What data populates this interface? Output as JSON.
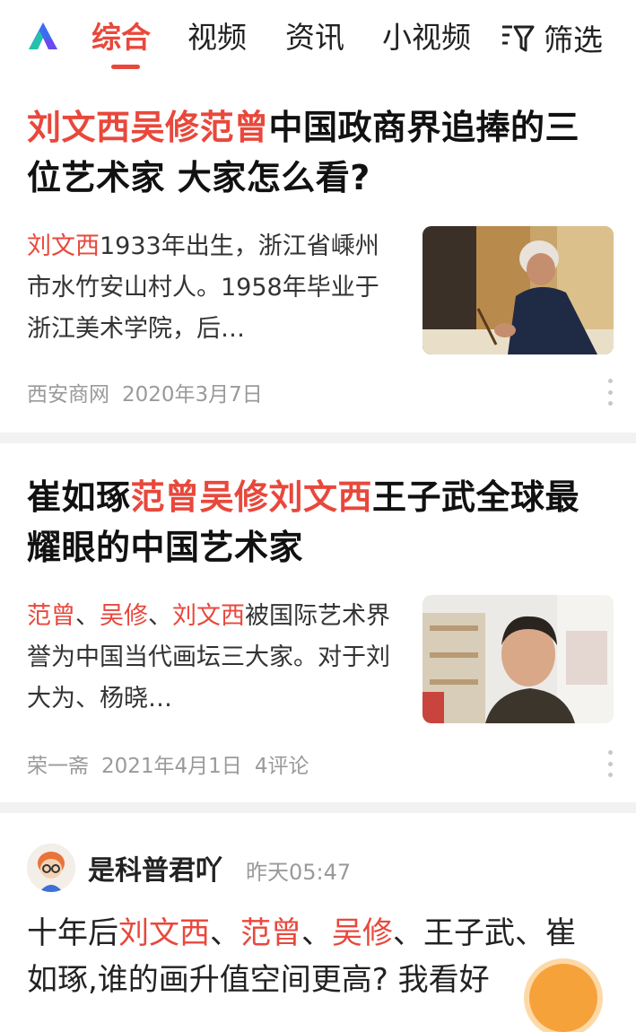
{
  "nav": {
    "logo": "baidu-app-logo-icon",
    "tabs": [
      {
        "label": "综合",
        "active": true
      },
      {
        "label": "视频",
        "active": false
      },
      {
        "label": "资讯",
        "active": false
      },
      {
        "label": "小视频",
        "active": false
      }
    ],
    "filter_label": "筛选",
    "accent_color": "#e8483c"
  },
  "articles": [
    {
      "title_parts": [
        {
          "text": "刘文西吴修范曾",
          "highlight": true
        },
        {
          "text": "中国政商界追捧的三位艺术家 大家怎么看?",
          "highlight": false
        }
      ],
      "snippet_parts": [
        {
          "text": "刘文西",
          "highlight": true
        },
        {
          "text": "1933年出生，浙江省嵊州市水竹安山村人。1958年毕业于浙江美术学院，后…",
          "highlight": false
        }
      ],
      "source": "西安商网",
      "date": "2020年3月7日",
      "comments": ""
    },
    {
      "title_parts": [
        {
          "text": "崔如琢",
          "highlight": false
        },
        {
          "text": "范曾吴修刘文西",
          "highlight": true
        },
        {
          "text": "王子武全球最耀眼的中国艺术家",
          "highlight": false
        }
      ],
      "snippet_parts": [
        {
          "text": "范曾",
          "highlight": true
        },
        {
          "text": "、",
          "highlight": false
        },
        {
          "text": "吴修",
          "highlight": true
        },
        {
          "text": "、",
          "highlight": false
        },
        {
          "text": "刘文西",
          "highlight": true
        },
        {
          "text": "被国际艺术界誉为中国当代画坛三大家。对于刘大为、杨晓…",
          "highlight": false
        }
      ],
      "source": "荣一斋",
      "date": "2021年4月1日",
      "comments": "4评论"
    }
  ],
  "post": {
    "author": "是科普君吖",
    "time": "昨天05:47",
    "text_parts": [
      {
        "text": "十年后",
        "highlight": false
      },
      {
        "text": "刘文西",
        "highlight": true
      },
      {
        "text": "、",
        "highlight": false
      },
      {
        "text": "范曾",
        "highlight": true
      },
      {
        "text": "、",
        "highlight": false
      },
      {
        "text": "吴修",
        "highlight": true
      },
      {
        "text": "、王子武、崔如琢,谁的画升值空间更高? 我看好",
        "highlight": false
      }
    ]
  }
}
